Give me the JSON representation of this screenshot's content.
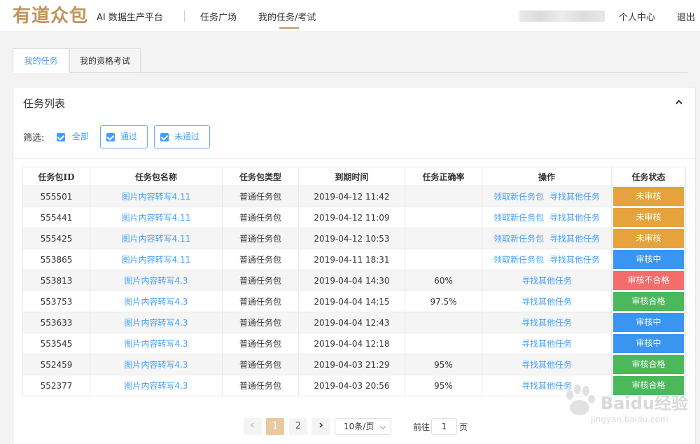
{
  "header": {
    "logo": "有道众包",
    "subtitle": "AI 数据生产平台",
    "nav": [
      "任务广场",
      "我的任务/考试"
    ],
    "links": {
      "profile": "个人中心",
      "logout": "退出"
    }
  },
  "tabs": [
    "我的任务",
    "我的资格考试"
  ],
  "panel": {
    "title": "任务列表",
    "filter": {
      "label": "筛选:",
      "all": "全部",
      "pass": "通过",
      "fail": "未通过"
    }
  },
  "table": {
    "headers": [
      "任务包ID",
      "任务包名称",
      "任务包类型",
      "到期时间",
      "任务正确率",
      "操作",
      "任务状态"
    ],
    "actions": {
      "claim": "领取新任务包",
      "find": "寻找其他任务"
    },
    "rows": [
      {
        "id": "555501",
        "name": "图片内容转写4.11",
        "type": "普通任务包",
        "due": "2019-04-12 11:42",
        "accuracy": "",
        "ops": [
          "领取新任务包",
          "寻找其他任务"
        ],
        "status": "未审核",
        "status_color": "orange"
      },
      {
        "id": "555441",
        "name": "图片内容转写4.11",
        "type": "普通任务包",
        "due": "2019-04-12 11:09",
        "accuracy": "",
        "ops": [
          "领取新任务包",
          "寻找其他任务"
        ],
        "status": "未审核",
        "status_color": "orange"
      },
      {
        "id": "555425",
        "name": "图片内容转写4.11",
        "type": "普通任务包",
        "due": "2019-04-12 10:53",
        "accuracy": "",
        "ops": [
          "领取新任务包",
          "寻找其他任务"
        ],
        "status": "未审核",
        "status_color": "orange"
      },
      {
        "id": "553865",
        "name": "图片内容转写4.11",
        "type": "普通任务包",
        "due": "2019-04-11 18:31",
        "accuracy": "",
        "ops": [
          "领取新任务包",
          "寻找其他任务"
        ],
        "status": "审核中",
        "status_color": "blue"
      },
      {
        "id": "553813",
        "name": "图片内容转写4.3",
        "type": "普通任务包",
        "due": "2019-04-04 14:30",
        "accuracy": "60%",
        "ops": [
          "寻找其他任务"
        ],
        "status": "审核不合格",
        "status_color": "red"
      },
      {
        "id": "553753",
        "name": "图片内容转写4.3",
        "type": "普通任务包",
        "due": "2019-04-04 14:15",
        "accuracy": "97.5%",
        "ops": [
          "寻找其他任务"
        ],
        "status": "审核合格",
        "status_color": "green"
      },
      {
        "id": "553633",
        "name": "图片内容转写4.3",
        "type": "普通任务包",
        "due": "2019-04-04 12:43",
        "accuracy": "",
        "ops": [
          "寻找其他任务"
        ],
        "status": "审核中",
        "status_color": "blue"
      },
      {
        "id": "553545",
        "name": "图片内容转写4.3",
        "type": "普通任务包",
        "due": "2019-04-04 12:18",
        "accuracy": "",
        "ops": [
          "寻找其他任务"
        ],
        "status": "审核中",
        "status_color": "blue"
      },
      {
        "id": "552459",
        "name": "图片内容转写4.3",
        "type": "普通任务包",
        "due": "2019-04-03 21:29",
        "accuracy": "95%",
        "ops": [
          "寻找其他任务"
        ],
        "status": "审核合格",
        "status_color": "green"
      },
      {
        "id": "552377",
        "name": "图片内容转写4.3",
        "type": "普通任务包",
        "due": "2019-04-03 20:56",
        "accuracy": "95%",
        "ops": [
          "寻找其他任务"
        ],
        "status": "审核合格",
        "status_color": "green"
      }
    ]
  },
  "pagination": {
    "pages": [
      "1",
      "2"
    ],
    "current": "1",
    "page_size": "10条/页",
    "goto_label": "前往",
    "goto_value": "1",
    "page_unit": "页"
  },
  "watermark": {
    "text": "Baidu经验",
    "url": "jingyan.baidu.com"
  },
  "colors": {
    "accent": "#409eff",
    "brand": "#c0955a",
    "orange": "#e6a23c",
    "blue": "#3a95f0",
    "red": "#f56c6c",
    "green": "#4bb85a"
  }
}
